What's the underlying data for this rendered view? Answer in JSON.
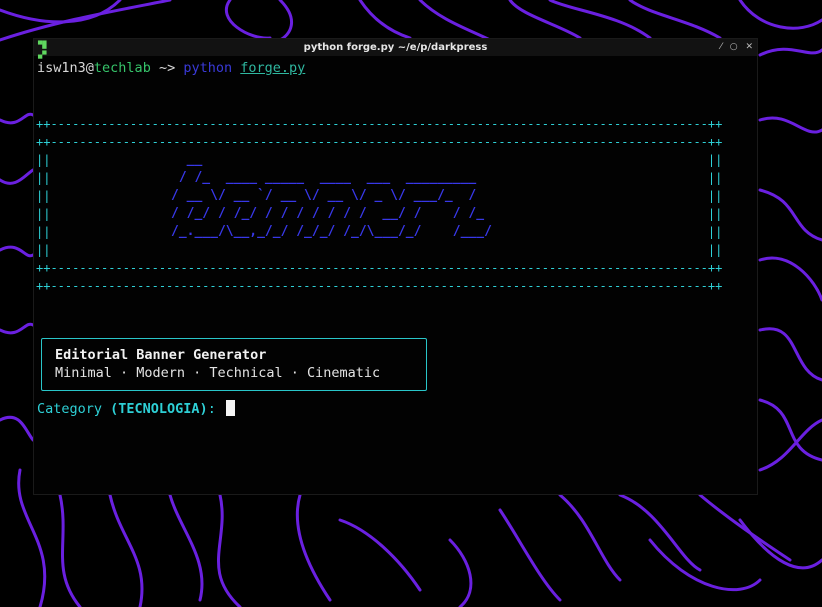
{
  "window": {
    "title": "python forge.py ~/e/p/darkpress",
    "icon": "terminal-icon",
    "controls": [
      "minimize-icon",
      "maximize-icon",
      "close-icon"
    ],
    "control_glyphs": [
      "⁄",
      "○",
      "✕"
    ]
  },
  "prompt": {
    "user": "isw1n3",
    "at": "@",
    "host": "techlab",
    "dir": " ~> ",
    "command": "python",
    "space": " ",
    "file": "forge.py"
  },
  "banner": {
    "ascii_art": "  __\n / /_  ____ _____  ____  ___  _________\n/ __ \\/ __ `/ __ \\/ __ \\/ _ \\/ ___/_  /\n/ /_/ / /_/ / / / / / / /  __/ /    / /_\n/_.___/\\__,_/_/ /_/_/ /_/\\___/_/    /___/",
    "frame_color": "#2ed0d6",
    "art_color": "#3838e8"
  },
  "info": {
    "title": "Editorial Banner Generator",
    "styles": "Minimal · Modern · Technical · Cinematic"
  },
  "input": {
    "label": "Category ",
    "default": "(TECNOLOGIA)",
    "suffix": ": "
  },
  "colors": {
    "wallpaper_lines": "#6a20e0",
    "accent_cyan": "#2ed0d6",
    "prompt_host": "#36c46a",
    "command_blue": "#3a3ad8"
  }
}
